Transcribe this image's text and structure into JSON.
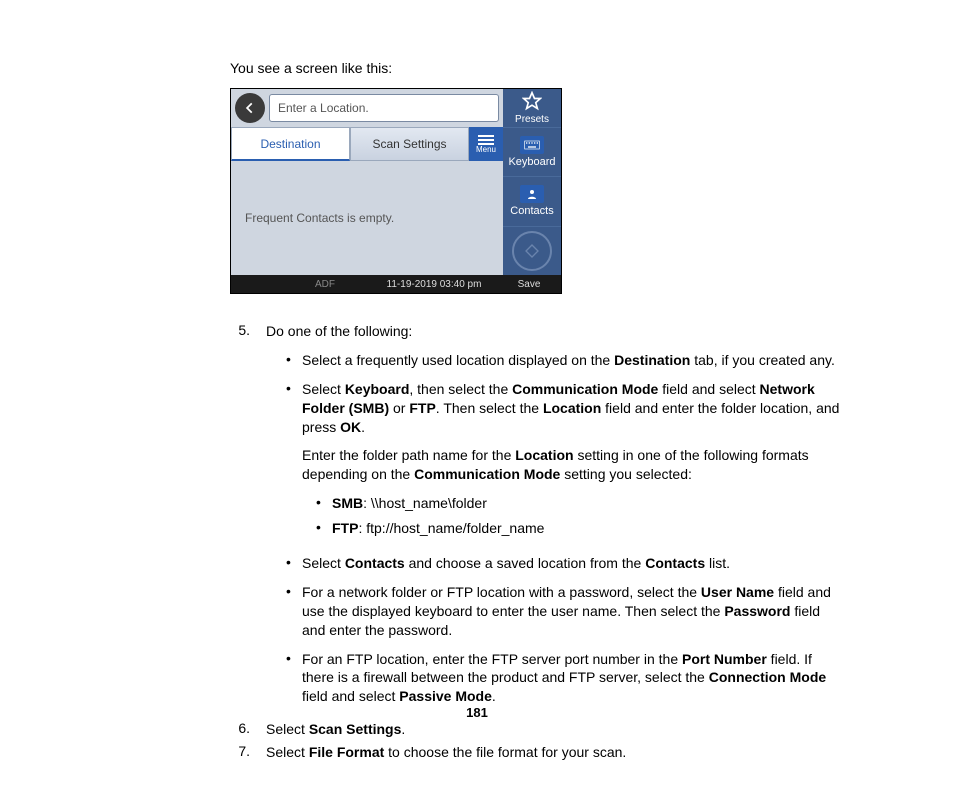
{
  "intro": "You see a screen like this:",
  "mock": {
    "placeholder": "Enter a Location.",
    "presets": "Presets",
    "tabs": {
      "destination": "Destination",
      "scan_settings": "Scan Settings",
      "menu": "Menu"
    },
    "empty": "Frequent Contacts is empty.",
    "keyboard": "Keyboard",
    "contacts": "Contacts",
    "adf": "ADF",
    "datetime": "11-19-2019 03:40 pm",
    "save": "Save"
  },
  "steps": {
    "n5": "5.",
    "n6": "6.",
    "n7": "7.",
    "s5_lead": "Do one of the following:",
    "bullets": {
      "b1_a": "Select a frequently used location displayed on the ",
      "b1_b": "Destination",
      "b1_c": " tab, if you created any.",
      "b2_a": "Select ",
      "b2_b": "Keyboard",
      "b2_c": ", then select the ",
      "b2_d": "Communication Mode",
      "b2_e": " field and select ",
      "b2_f": "Network Folder (SMB)",
      "b2_g": " or ",
      "b2_h": "FTP",
      "b2_i": ". Then select the ",
      "b2_j": "Location",
      "b2_k": " field and enter the folder location, and press ",
      "b2_l": "OK",
      "b2_m": ".",
      "b2p2_a": "Enter the folder path name for the ",
      "b2p2_b": "Location",
      "b2p2_c": " setting in one of the following formats depending on the ",
      "b2p2_d": "Communication Mode",
      "b2p2_e": " setting you selected:",
      "smb_a": "SMB",
      "smb_b": ": \\\\host_name\\folder",
      "ftp_a": "FTP",
      "ftp_b": ": ftp://host_name/folder_name",
      "b3_a": "Select ",
      "b3_b": "Contacts",
      "b3_c": " and choose a saved location from the ",
      "b3_d": "Contacts",
      "b3_e": " list.",
      "b4_a": "For a network folder or FTP location with a password, select the ",
      "b4_b": "User Name",
      "b4_c": " field and use the displayed keyboard to enter the user name. Then select the ",
      "b4_d": "Password",
      "b4_e": " field and enter the password.",
      "b5_a": "For an FTP location, enter the FTP server port number in the ",
      "b5_b": "Port Number",
      "b5_c": " field. If there is a firewall between the product and FTP server, select the ",
      "b5_d": "Connection Mode",
      "b5_e": " field and select ",
      "b5_f": "Passive Mode",
      "b5_g": "."
    },
    "s6_a": "Select ",
    "s6_b": "Scan Settings",
    "s6_c": ".",
    "s7_a": "Select ",
    "s7_b": "File Format",
    "s7_c": " to choose the file format for your scan."
  },
  "page_number": "181"
}
